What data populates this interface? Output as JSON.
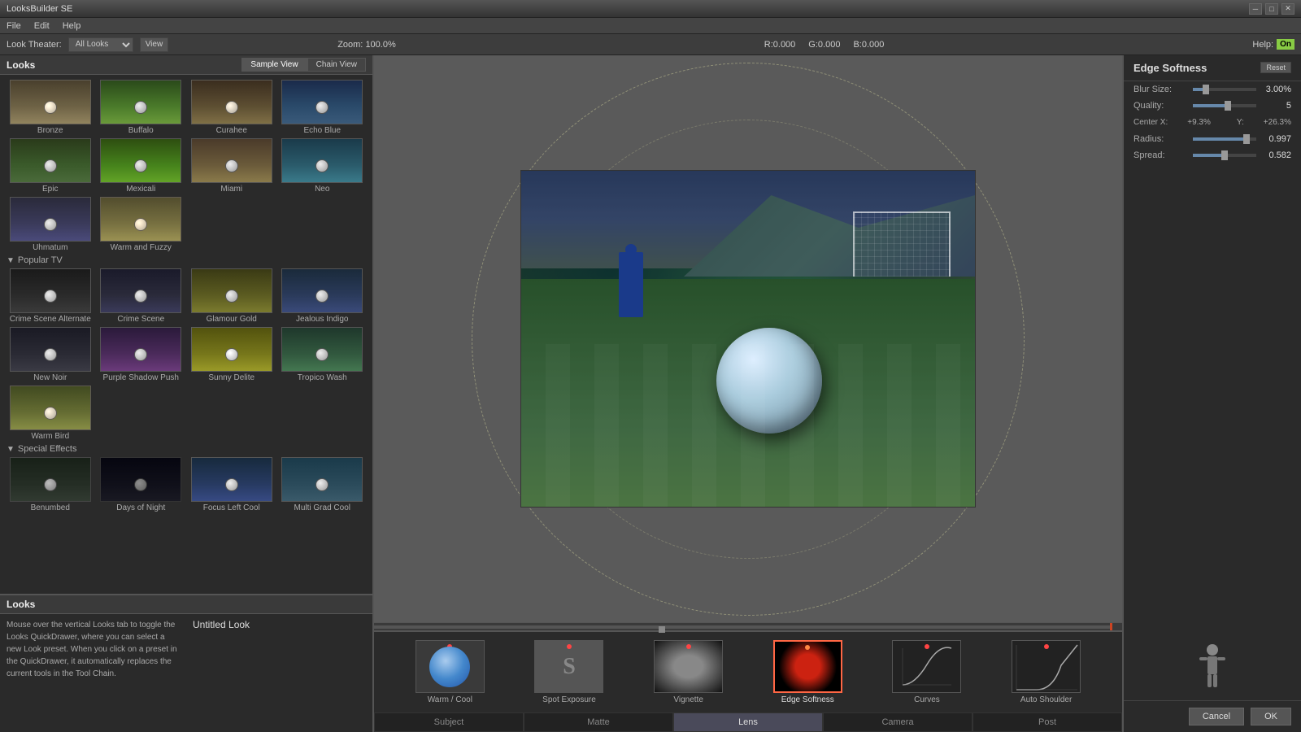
{
  "app": {
    "title": "LooksBuilder SE",
    "menu": [
      "File",
      "Edit",
      "Help"
    ]
  },
  "toolbar": {
    "look_theater_label": "Look Theater:",
    "all_looks": "All Looks",
    "view_btn": "View",
    "zoom_label": "Zoom:",
    "zoom_value": "100.0%",
    "r_label": "R:",
    "r_value": "0.000",
    "g_label": "G:",
    "g_value": "0.000",
    "b_label": "B:",
    "b_value": "0.000",
    "help_label": "Help:",
    "help_status": "On"
  },
  "looks_panel": {
    "title": "Looks",
    "tab_sample": "Sample View",
    "tab_chain": "Chain View",
    "sections": [
      {
        "name": "popular_tv_hidden",
        "collapsed": false,
        "items": [
          {
            "id": "bronze",
            "label": "Bronze"
          },
          {
            "id": "buffalo",
            "label": "Buffalo"
          },
          {
            "id": "curahee",
            "label": "Curahee"
          },
          {
            "id": "echo_blue",
            "label": "Echo Blue"
          },
          {
            "id": "epic",
            "label": "Epic"
          },
          {
            "id": "mexicali",
            "label": "Mexicali"
          },
          {
            "id": "miami",
            "label": "Miami"
          },
          {
            "id": "neo",
            "label": "Neo"
          },
          {
            "id": "uhmatum",
            "label": "Uhmatum"
          },
          {
            "id": "warm_fuzzy",
            "label": "Warm and Fuzzy"
          }
        ]
      },
      {
        "name": "Popular TV",
        "collapsed": false,
        "items": [
          {
            "id": "crime_alt",
            "label": "Crime Scene Alternate"
          },
          {
            "id": "crime",
            "label": "Crime Scene"
          },
          {
            "id": "glamour",
            "label": "Glamour Gold"
          },
          {
            "id": "jealous",
            "label": "Jealous Indigo"
          },
          {
            "id": "newnoir",
            "label": "New Noir"
          },
          {
            "id": "purple",
            "label": "Purple Shadow Push"
          },
          {
            "id": "sunny",
            "label": "Sunny Delite"
          },
          {
            "id": "tropico",
            "label": "Tropico Wash"
          },
          {
            "id": "warmbird",
            "label": "Warm Bird"
          }
        ]
      },
      {
        "name": "Special Effects",
        "collapsed": false,
        "items": [
          {
            "id": "benumbed",
            "label": "Benumbed"
          },
          {
            "id": "days",
            "label": "Days of Night"
          },
          {
            "id": "focus",
            "label": "Focus Left Cool"
          },
          {
            "id": "multigrad",
            "label": "Multi Grad Cool"
          }
        ]
      }
    ]
  },
  "looks_info": {
    "title": "Looks",
    "current_look": "Untitled Look",
    "description": "Mouse over the vertical Looks tab to toggle the Looks QuickDrawer, where you can select a new Look preset. When you click on a preset in the QuickDrawer, it automatically replaces the current tools in the Tool Chain."
  },
  "toolchain": {
    "tools": [
      {
        "id": "warmc",
        "label": "Warm / Cool",
        "active": false
      },
      {
        "id": "spot",
        "label": "Spot Exposure",
        "active": false
      },
      {
        "id": "vignette",
        "label": "Vignette",
        "active": false
      },
      {
        "id": "edgesoft",
        "label": "Edge Softness",
        "active": true,
        "selected": true
      },
      {
        "id": "curves",
        "label": "Curves",
        "active": false
      },
      {
        "id": "autoshoulder",
        "label": "Auto Shoulder",
        "active": false
      }
    ],
    "tabs": [
      "Subject",
      "Matte",
      "Lens",
      "Camera",
      "Post"
    ],
    "active_tab": "Lens"
  },
  "edge_softness": {
    "title": "Edge Softness",
    "reset_btn": "Reset",
    "params": [
      {
        "label": "Blur Size:",
        "value": "3.00%",
        "fill_pct": 15
      },
      {
        "label": "Quality:",
        "value": "5",
        "fill_pct": 50
      },
      {
        "label": "Center X:",
        "value": "+9.3%",
        "extra": "Y: +26.3%"
      },
      {
        "label": "Radius:",
        "value": "0.997",
        "fill_pct": 80
      },
      {
        "label": "Spread:",
        "value": "0.582",
        "fill_pct": 45
      }
    ]
  },
  "ok_cancel": {
    "cancel_label": "Cancel",
    "ok_label": "OK"
  }
}
